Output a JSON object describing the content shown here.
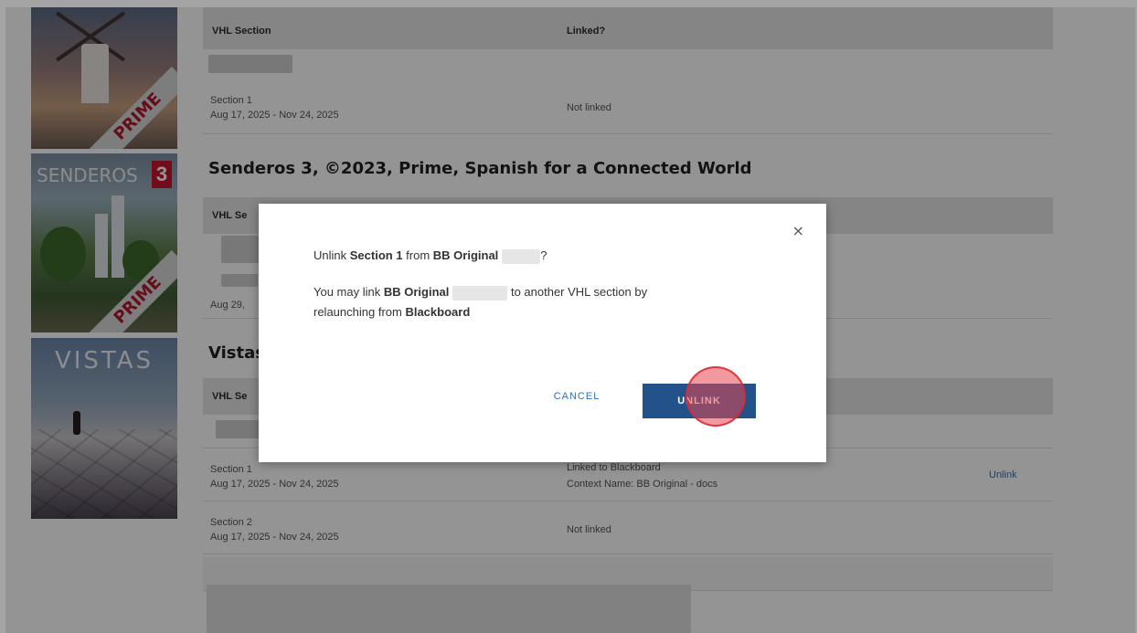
{
  "table1": {
    "header_section": "VHL Section",
    "header_linked": "Linked?",
    "row1": {
      "section": "Section 1",
      "dates": "Aug 17, 2025 - Nov 24, 2025",
      "status": "Not linked"
    }
  },
  "senderos": {
    "heading": "Senderos 3, ©2023, Prime, Spanish for a Connected World",
    "header_section": "VHL Se",
    "row_dates_partial": "Aug 29,"
  },
  "vistas": {
    "heading_partial": "Vistas",
    "header_section": "VHL Se",
    "row1": {
      "section": "Section 1",
      "dates": "Aug 17, 2025 - Nov 24, 2025",
      "status": "Linked to Blackboard",
      "context": "Context Name: BB Original - docs",
      "action": "Unlink"
    },
    "row2": {
      "section": "Section 2",
      "dates": "Aug 17, 2025 - Nov 24, 2025",
      "status": "Not linked"
    }
  },
  "covers": {
    "cover1_ribbon": "PRIME",
    "cover2_title": "SENDEROS",
    "cover2_number": "3",
    "cover2_ribbon": "PRIME",
    "cover3_title": "VISTAS"
  },
  "modal": {
    "close_icon": "×",
    "line1_prefix": "Unlink ",
    "line1_section": "Section 1",
    "line1_mid": " from ",
    "line1_course": "BB Original",
    "line1_suffix": "?",
    "line2_prefix": "You may link ",
    "line2_course": "BB Original",
    "line2_mid": " to another VHL section by",
    "line3_prefix": "relaunching from ",
    "line3_platform": "Blackboard",
    "cancel_label": "CANCEL",
    "unlink_label": "UNLINK"
  },
  "colors": {
    "primary_button": "#23528a",
    "link": "#2f6fb4",
    "click_indicator": "#e64650"
  }
}
